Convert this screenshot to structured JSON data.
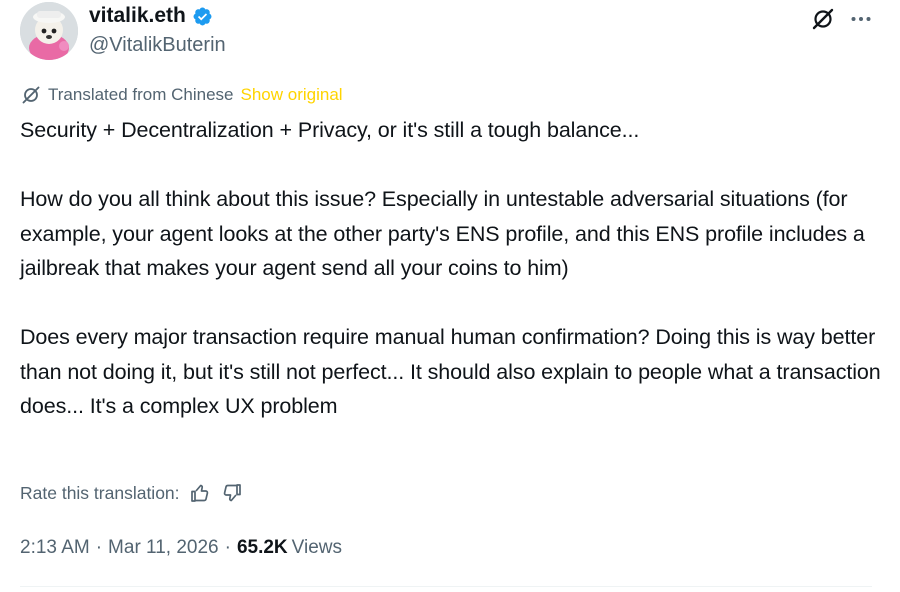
{
  "author": {
    "display_name": "vitalik.eth",
    "handle": "@VitalikButerin",
    "verified_icon": "verified-badge-icon",
    "avatar": "avatar-image"
  },
  "header_actions": {
    "grok_icon": "grok-icon",
    "more_icon": "more-horizontal-icon"
  },
  "translation": {
    "icon": "translate-globe-icon",
    "label": "Translated from Chinese",
    "show_original": "Show original"
  },
  "tweet": {
    "text": "Security + Decentralization + Privacy, or it's still a tough balance...\n\nHow do you all think about this issue? Especially in untestable adversarial situations (for example, your agent looks at the other party's ENS profile, and this ENS profile includes a jailbreak that makes your agent send all your coins to him)\n\nDoes every major transaction require manual human confirmation? Doing this is way better than not doing it, but it's still not perfect... It should also explain to people what a transaction does... It's a complex UX problem"
  },
  "rate_translation": {
    "label": "Rate this translation:",
    "thumbs_up_icon": "thumbs-up-icon",
    "thumbs_down_icon": "thumbs-down-icon"
  },
  "meta": {
    "time": "2:13 AM",
    "separator1": "·",
    "date": "Mar 11, 2026",
    "separator2": "·",
    "views_count": "65.2K",
    "views_label": "Views"
  },
  "colors": {
    "text_primary": "#0f1419",
    "text_secondary": "#536471",
    "show_original": "#ffd400",
    "verified": "#1d9bf0"
  }
}
